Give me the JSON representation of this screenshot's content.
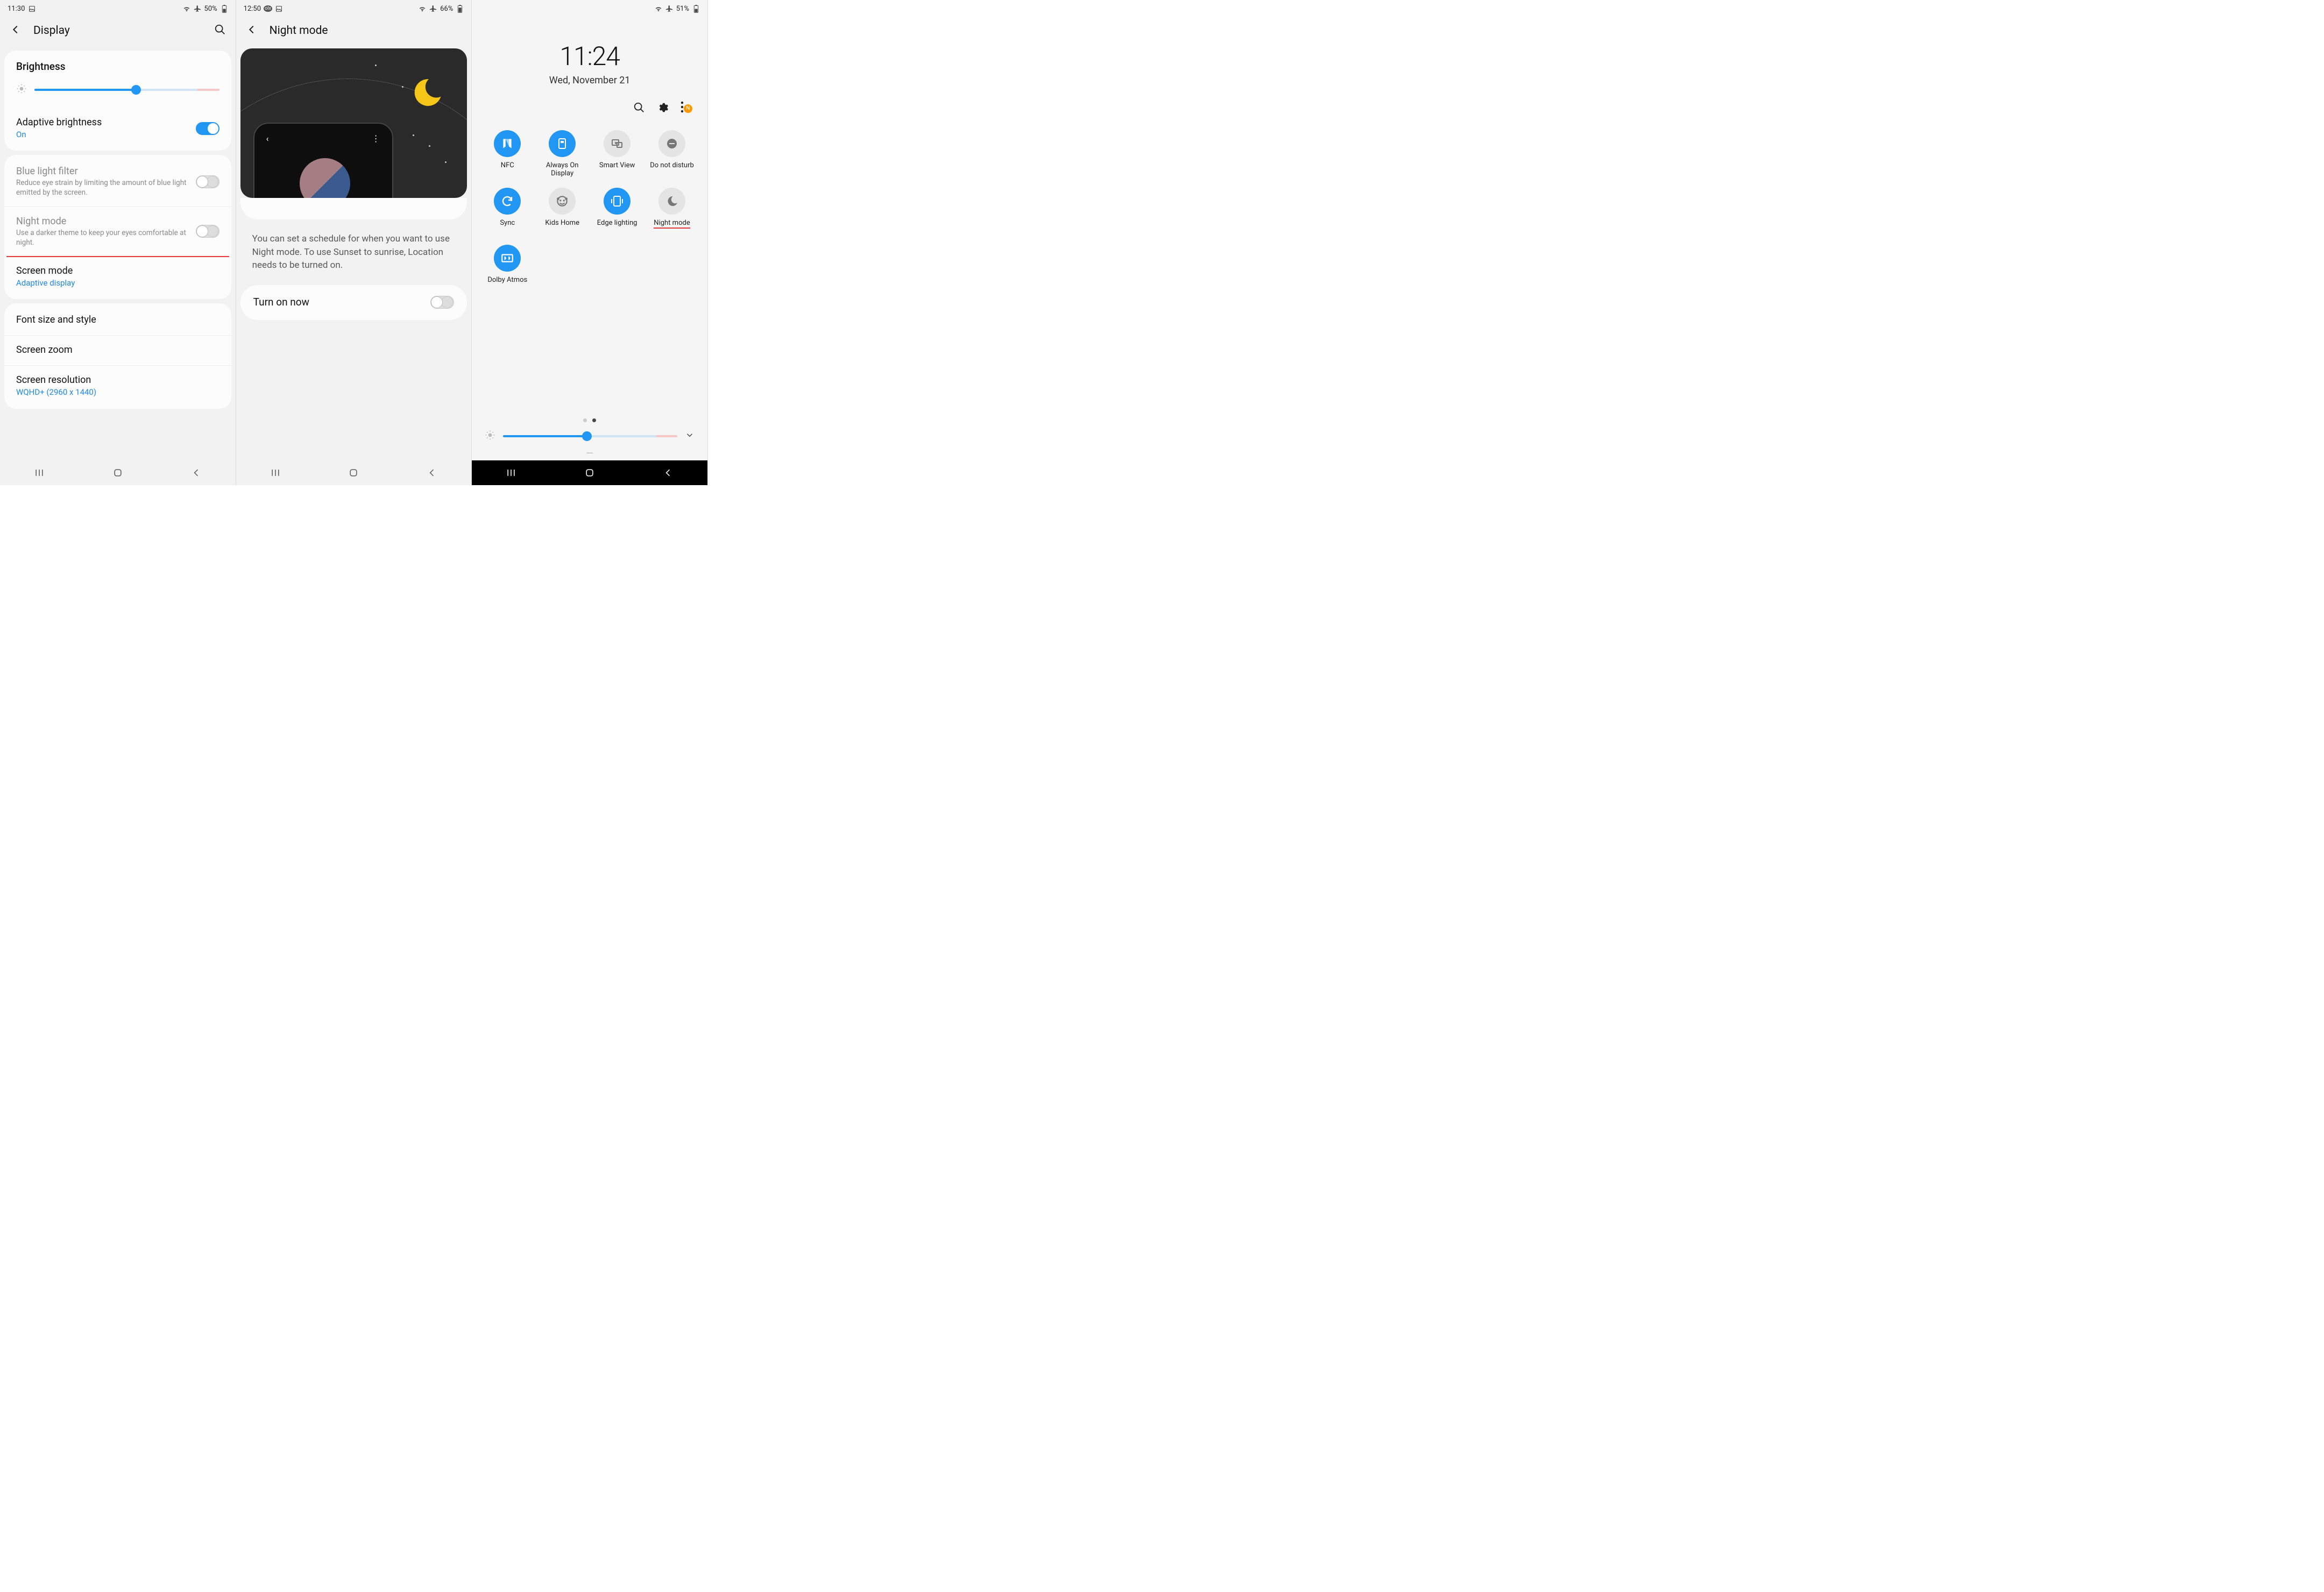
{
  "phone1": {
    "status": {
      "time": "11:30",
      "battery": "50%"
    },
    "title": "Display",
    "brightness_label": "Brightness",
    "adaptive": {
      "title": "Adaptive brightness",
      "value": "On"
    },
    "bluelight": {
      "title": "Blue light filter",
      "sub": "Reduce eye strain by limiting the amount of blue light emitted by the screen."
    },
    "nightmode": {
      "title": "Night mode",
      "sub": "Use a darker theme to keep your eyes comfortable at night."
    },
    "screenmode": {
      "title": "Screen mode",
      "sub": "Adaptive display"
    },
    "fontsize": "Font size and style",
    "screenzoom": "Screen zoom",
    "resolution": {
      "title": "Screen resolution",
      "sub": "WQHD+ (2960 x 1440)"
    }
  },
  "phone2": {
    "status": {
      "time": "12:50",
      "battery": "66%"
    },
    "title": "Night mode",
    "info": "You can set a schedule for when you want to use Night mode. To use Sunset to sunrise, Location needs to be turned on.",
    "turn_on": "Turn on now"
  },
  "phone3": {
    "status": {
      "battery": "51%"
    },
    "time": "11:24",
    "date": "Wed, November 21",
    "tiles": [
      {
        "label": "NFC",
        "on": true,
        "glyph": "N"
      },
      {
        "label": "Always On Display",
        "on": true,
        "glyph": "AOD"
      },
      {
        "label": "Smart View",
        "on": false,
        "glyph": "SV"
      },
      {
        "label": "Do not disturb",
        "on": false,
        "glyph": "–"
      },
      {
        "label": "Sync",
        "on": true,
        "glyph": "↻"
      },
      {
        "label": "Kids Home",
        "on": false,
        "glyph": "KH"
      },
      {
        "label": "Edge lighting",
        "on": true,
        "glyph": "EL"
      },
      {
        "label": "Night mode",
        "on": false,
        "glyph": "☾",
        "underline": true
      },
      {
        "label": "Dolby Atmos",
        "on": true,
        "glyph": "DD"
      }
    ]
  }
}
